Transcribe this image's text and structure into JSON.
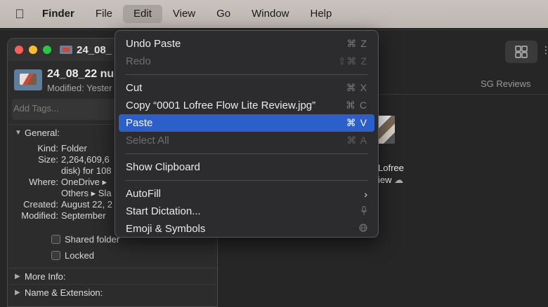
{
  "menubar": {
    "apple_icon": "apple-icon",
    "items": [
      "Finder",
      "File",
      "Edit",
      "View",
      "Go",
      "Window",
      "Help"
    ],
    "active": "Edit"
  },
  "background_window": {
    "column_header": "SG Reviews",
    "file_name_line1": "Lofree",
    "file_name_line2": "iew"
  },
  "info_window": {
    "title": "24_08_",
    "name": "24_08_22 nu",
    "modified": "Modified: Yester",
    "tags_placeholder": "Add Tags...",
    "general_label": "General:",
    "rows": [
      {
        "k": "Kind:",
        "v": "Folder"
      },
      {
        "k": "Size:",
        "v": "2,264,609,6"
      },
      {
        "k": "",
        "v": "disk) for 108"
      },
      {
        "k": "Where:",
        "v": "OneDrive ▸"
      },
      {
        "k": "",
        "v": "Others ▸ Sla"
      },
      {
        "k": "Created:",
        "v": "August 22, 2"
      },
      {
        "k": "Modified:",
        "v": "September"
      }
    ],
    "shared_folder": "Shared folder",
    "locked": "Locked",
    "more_info": "More Info:",
    "name_ext": "Name & Extension:"
  },
  "edit_menu": {
    "undo": {
      "label": "Undo Paste",
      "shortcut": "⌘ Z"
    },
    "redo": {
      "label": "Redo",
      "shortcut": "⇧⌘ Z"
    },
    "cut": {
      "label": "Cut",
      "shortcut": "⌘ X"
    },
    "copy": {
      "label": "Copy “0001 Lofree Flow Lite Review.jpg”",
      "shortcut": "⌘ C"
    },
    "paste": {
      "label": "Paste",
      "shortcut": "⌘ V"
    },
    "select_all": {
      "label": "Select All",
      "shortcut": "⌘ A"
    },
    "show_clipboard": {
      "label": "Show Clipboard"
    },
    "autofill": {
      "label": "AutoFill"
    },
    "dictation": {
      "label": "Start Dictation..."
    },
    "emoji": {
      "label": "Emoji & Symbols"
    }
  },
  "colors": {
    "selection": "#2b5fc9",
    "menubar": "#c4beb9"
  }
}
